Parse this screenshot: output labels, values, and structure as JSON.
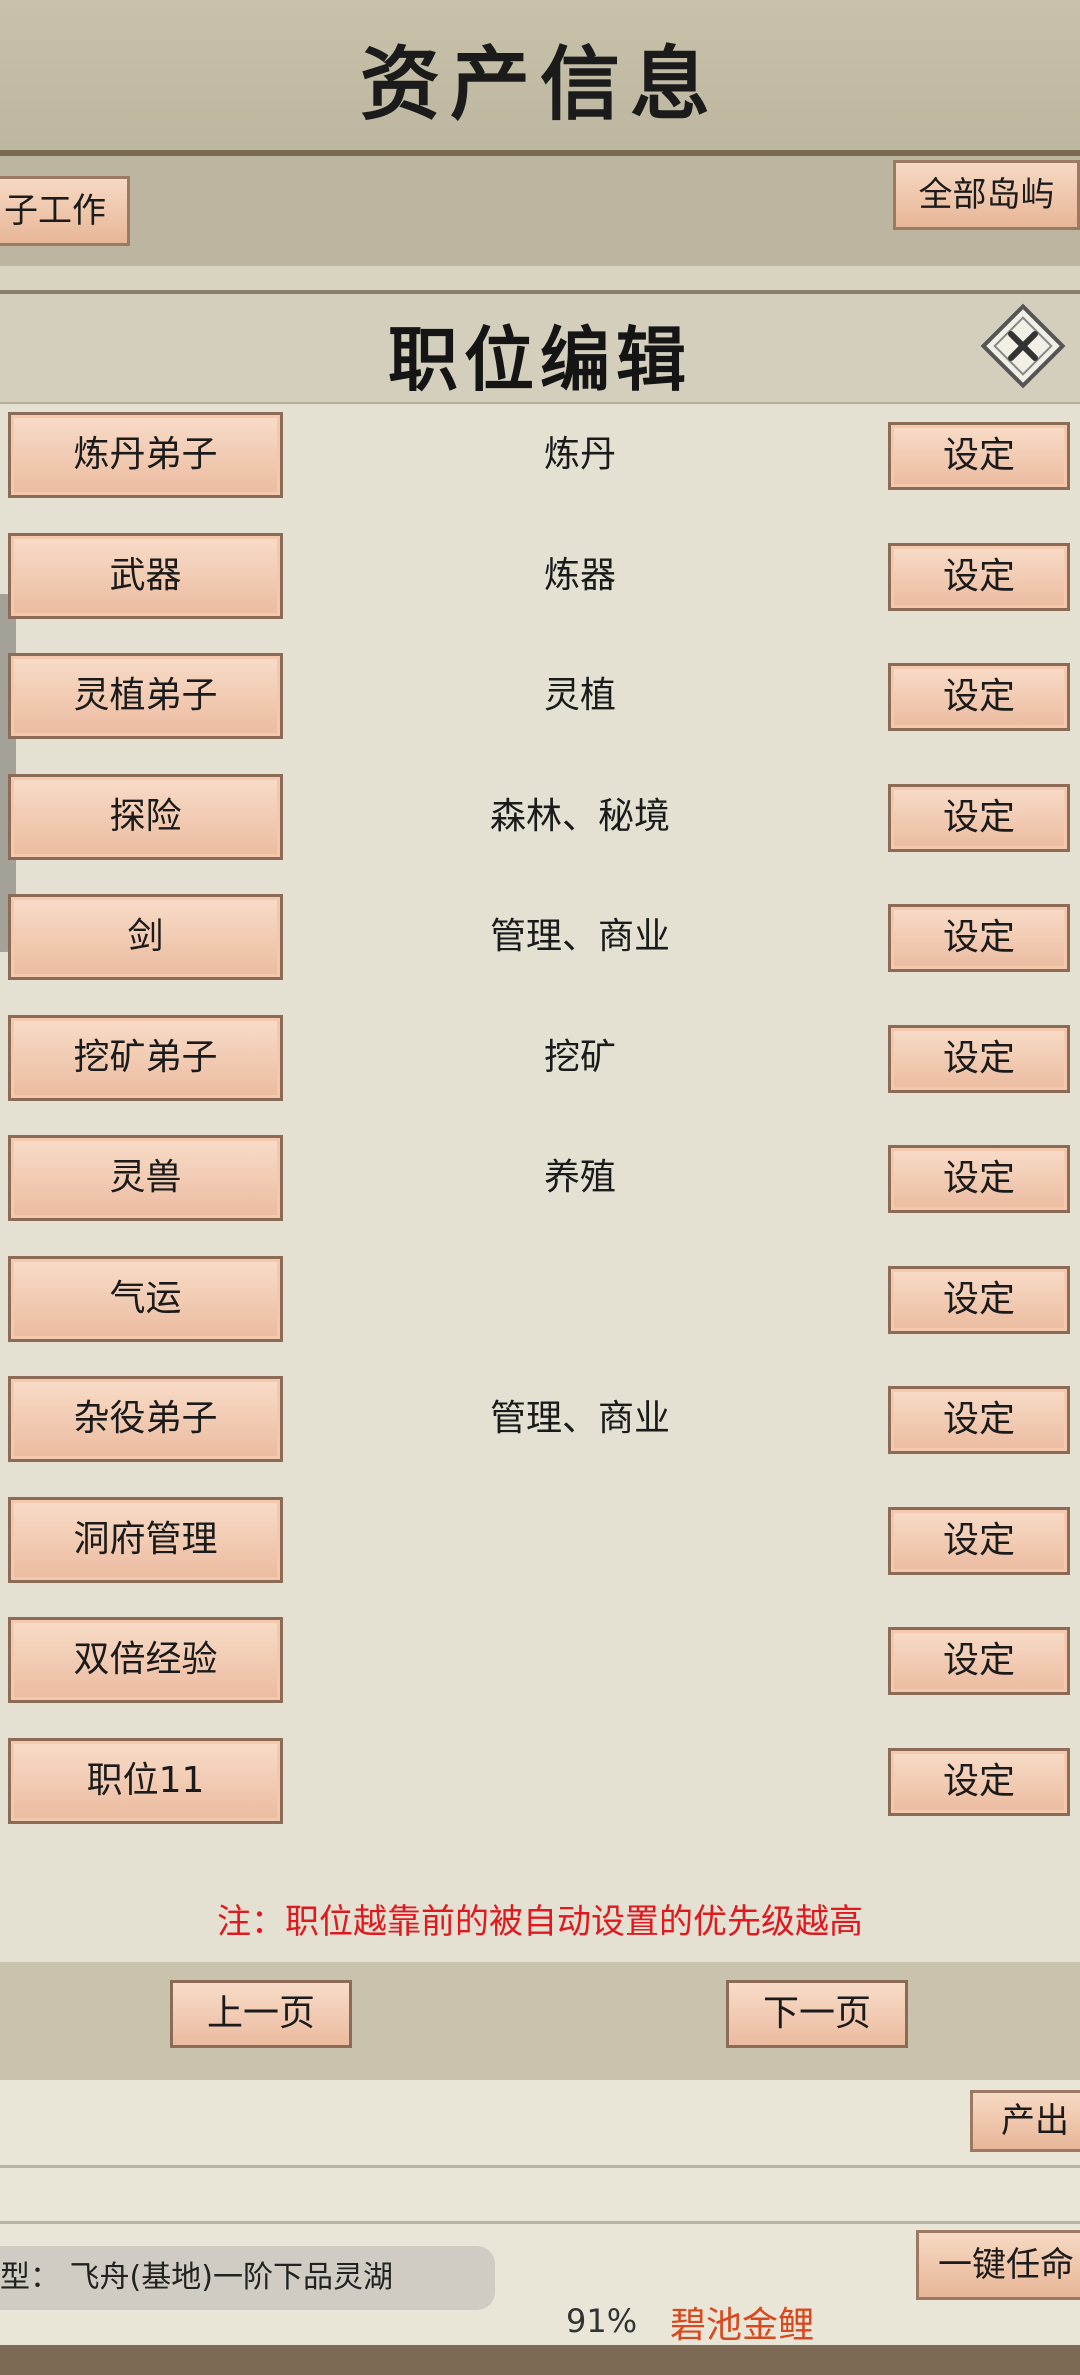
{
  "background": {
    "title": "资产信息",
    "left_button": "子工作",
    "right_button": "全部岛屿",
    "produce_button": "产出",
    "auto_button": "一键任命",
    "type_text": "型： 飞舟(基地)一阶下品灵湖",
    "percent": "91%",
    "fish": "碧池金鲤"
  },
  "modal": {
    "title": "职位编辑",
    "rows": [
      {
        "name": "炼丹弟子",
        "location": "炼丹",
        "action": "设定"
      },
      {
        "name": "武器",
        "location": "炼器",
        "action": "设定"
      },
      {
        "name": "灵植弟子",
        "location": "灵植",
        "action": "设定"
      },
      {
        "name": "探险",
        "location": "森林、秘境",
        "action": "设定"
      },
      {
        "name": "剑",
        "location": "管理、商业",
        "action": "设定"
      },
      {
        "name": "挖矿弟子",
        "location": "挖矿",
        "action": "设定"
      },
      {
        "name": "灵兽",
        "location": "养殖",
        "action": "设定"
      },
      {
        "name": "气运",
        "location": "",
        "action": "设定"
      },
      {
        "name": "杂役弟子",
        "location": "管理、商业",
        "action": "设定"
      },
      {
        "name": "洞府管理",
        "location": "",
        "action": "设定"
      },
      {
        "name": "双倍经验",
        "location": "",
        "action": "设定"
      },
      {
        "name": "职位11",
        "location": "",
        "action": "设定"
      }
    ],
    "note": "注：职位越靠前的被自动设置的优先级越高",
    "prev_page": "上一页",
    "next_page": "下一页"
  }
}
